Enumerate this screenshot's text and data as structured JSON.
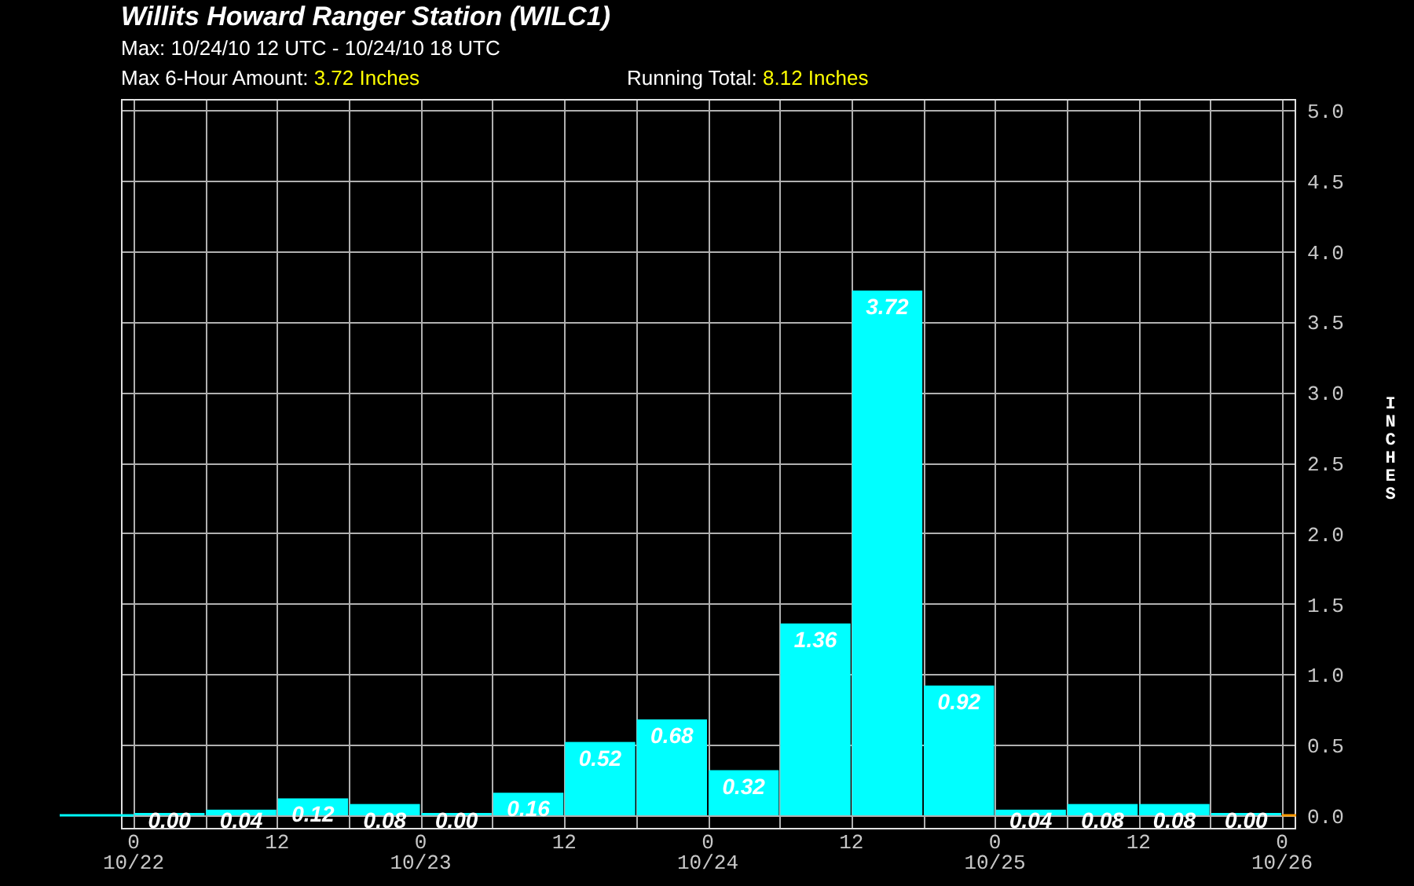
{
  "header": {
    "title": "Willits Howard Ranger Station (WILC1)",
    "max_period": "Max: 10/24/10 12 UTC - 10/24/10 18 UTC",
    "max_amount": {
      "label": "Max 6-Hour Amount:",
      "value": "3.72 Inches"
    },
    "running_total": {
      "label": "Running Total:",
      "value": "8.12 Inches"
    }
  },
  "chart": {
    "chart_data": {
      "type": "bar",
      "ylabel": "INCHES",
      "grid": true,
      "categories": [
        null,
        null,
        null,
        null,
        null,
        null,
        null,
        null,
        null,
        null,
        null,
        null,
        null,
        null,
        null,
        null
      ],
      "values": [
        0,
        0.04,
        0.12,
        0.08,
        0,
        0.16,
        0.52,
        0.68,
        0.32,
        1.36,
        3.72,
        0.92,
        0.04,
        0.08,
        0.08,
        0
      ],
      "value_labels": [
        "0.00",
        "0.04",
        "0.12",
        "0.08",
        "0.00",
        "0.16",
        "0.52",
        "0.68",
        "0.32",
        "1.36",
        "3.72",
        "0.92",
        "0.04",
        "0.08",
        "0.08",
        "0.00"
      ],
      "ylim": [
        0,
        5
      ],
      "yticks": [
        {
          "value": 0,
          "label": "0.0"
        },
        {
          "value": 0.5,
          "label": "0.5"
        },
        {
          "value": 1,
          "label": "1.0"
        },
        {
          "value": 1.5,
          "label": "1.5"
        },
        {
          "value": 2,
          "label": "2.0"
        },
        {
          "value": 2.5,
          "label": "2.5"
        },
        {
          "value": 3,
          "label": "3.0"
        },
        {
          "value": 3.5,
          "label": "3.5"
        },
        {
          "value": 4,
          "label": "4.0"
        },
        {
          "value": 4.5,
          "label": "4.5"
        },
        {
          "value": 5,
          "label": "5.0"
        }
      ]
    },
    "x_axis_labels": [
      {
        "hour": "0",
        "date": "10/22"
      },
      {
        "hour": "12"
      },
      {
        "hour": "0",
        "date": "10/23"
      },
      {
        "hour": "12"
      },
      {
        "hour": "0",
        "date": "10/24"
      },
      {
        "hour": "12"
      },
      {
        "hour": "0",
        "date": "10/25"
      },
      {
        "hour": "12"
      },
      {
        "hour": "0",
        "date": "10/26"
      }
    ]
  }
}
